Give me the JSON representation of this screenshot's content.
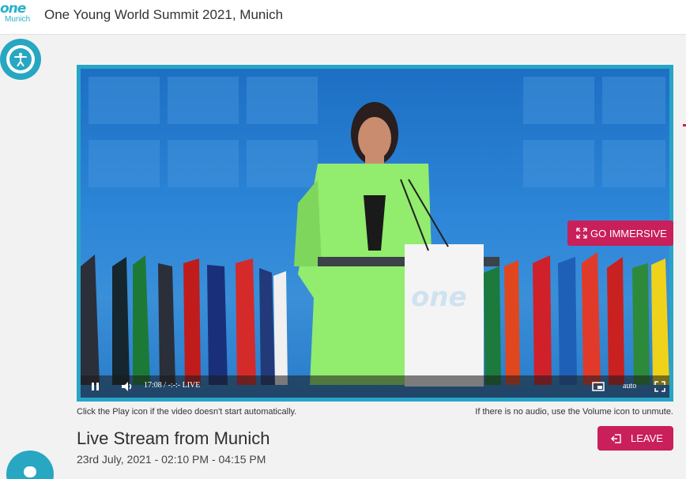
{
  "header": {
    "logo_text": "one",
    "logo_subtext": "Munich",
    "title": "One Young World Summit 2021, Munich"
  },
  "accessibility": {
    "icon": "accessibility-icon"
  },
  "video": {
    "immersive_label": "GO IMMERSIVE",
    "podium_logo": "one",
    "time": "17:08 / -:-:- LIVE",
    "quality": "auto",
    "icons": [
      "pause-icon",
      "volume-icon",
      "picture-in-picture-icon",
      "fullscreen-icon",
      "expand-icon"
    ]
  },
  "notes": {
    "play_hint": "Click the Play icon if the video doesn't start automatically.",
    "audio_hint": "If there is no audio, use the Volume icon to unmute."
  },
  "stream": {
    "title": "Live Stream from Munich",
    "date": "23rd July, 2021 - 02:10 PM - 04:15 PM",
    "leave_label": "LEAVE"
  },
  "colors": {
    "accent": "#27a7c1",
    "action": "#c91f5b",
    "background": "#f2f2f2"
  }
}
